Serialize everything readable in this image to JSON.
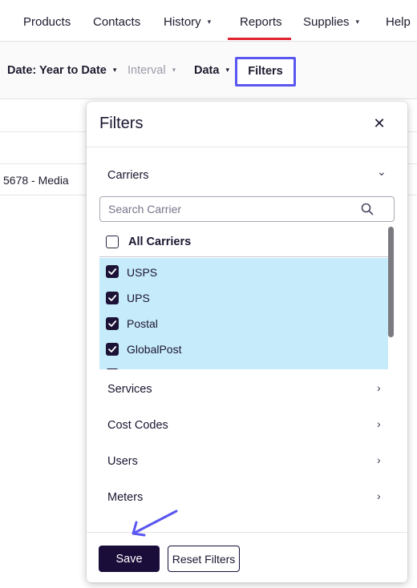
{
  "nav": {
    "items": [
      {
        "label": "Products",
        "caret": ""
      },
      {
        "label": "Contacts",
        "caret": ""
      },
      {
        "label": "History",
        "caret": "▾"
      },
      {
        "label": "Reports",
        "caret": ""
      },
      {
        "label": "Supplies",
        "caret": "▾"
      },
      {
        "label": "Help",
        "caret": ""
      }
    ],
    "active": "Reports",
    "accent_color": "#e0242f"
  },
  "toolbar": {
    "date_label": "Date: Year to Date",
    "interval_label": "Interval",
    "data_label": "Data",
    "filters_label": "Filters",
    "caret": "▾",
    "highlight_color": "#5a56f0"
  },
  "background_table": {
    "row_text": "5678 - Media"
  },
  "modal": {
    "title": "Filters",
    "close_glyph": "✕",
    "carriers": {
      "label": "Carriers",
      "chevron": "⌄",
      "search_placeholder": "Search Carrier",
      "all_label": "All Carriers",
      "all_checked": false,
      "items": [
        {
          "label": "USPS",
          "checked": true
        },
        {
          "label": "UPS",
          "checked": true
        },
        {
          "label": "Postal",
          "checked": true
        },
        {
          "label": "GlobalPost",
          "checked": true
        },
        {
          "label": "",
          "checked": true
        }
      ],
      "selected_bg": "#c6ebfa"
    },
    "sections": [
      {
        "label": "Services",
        "chevron": "›"
      },
      {
        "label": "Cost Codes",
        "chevron": "›"
      },
      {
        "label": "Users",
        "chevron": "›"
      },
      {
        "label": "Meters",
        "chevron": "›"
      }
    ],
    "footer": {
      "save_label": "Save",
      "reset_label": "Reset Filters",
      "primary_color": "#1b0d3a"
    }
  },
  "annotation": {
    "arrow_color": "#5a56f0",
    "arrow_icon": "arrow-annotation-icon"
  }
}
